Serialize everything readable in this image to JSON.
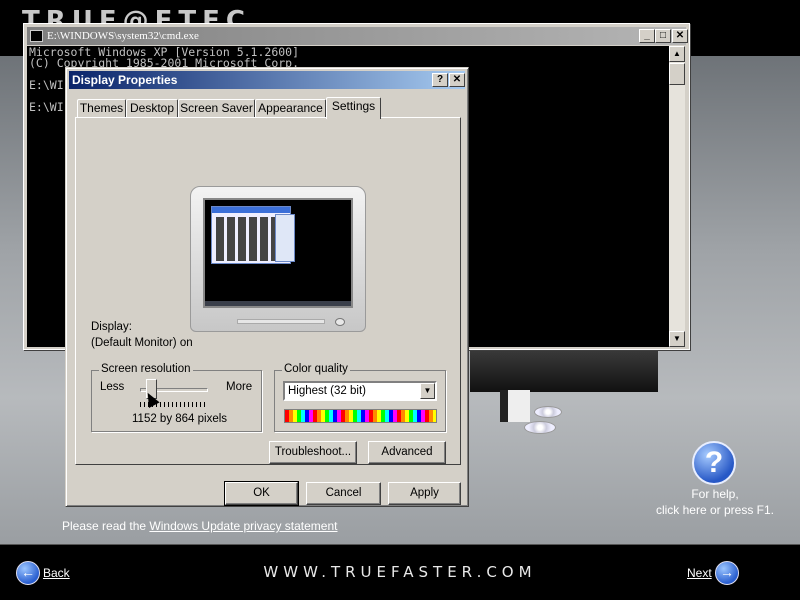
{
  "background": {
    "brand": "TRUE@FTEC",
    "website": "WWW.TRUEFASTER.COM",
    "back_label": "Back",
    "next_label": "Next",
    "help_line1": "For help,",
    "help_line2": "click here or press F1.",
    "privacy_prefix": "Please read the ",
    "privacy_link": "Windows Update privacy statement"
  },
  "cmd": {
    "title": "E:\\WINDOWS\\system32\\cmd.exe",
    "lines": [
      "Microsoft Windows XP [Version 5.1.2600]",
      "(C) Copyright 1985-2001 Microsoft Corp.",
      "",
      "E:\\WI",
      "",
      "E:\\WI"
    ]
  },
  "dialog": {
    "title": "Display Properties",
    "tabs": [
      "Themes",
      "Desktop",
      "Screen Saver",
      "Appearance",
      "Settings"
    ],
    "active_tab": "Settings",
    "display_label": "Display:",
    "display_value": "(Default Monitor) on",
    "resolution": {
      "caption": "Screen resolution",
      "less": "Less",
      "more": "More",
      "value": "1152 by 864 pixels"
    },
    "color_quality": {
      "caption": "Color quality",
      "selected": "Highest (32 bit)"
    },
    "buttons": {
      "troubleshoot": "Troubleshoot...",
      "advanced": "Advanced",
      "ok": "OK",
      "cancel": "Cancel",
      "apply": "Apply"
    }
  },
  "colors": {
    "title_active": "#0a246a",
    "title_inactive": "#7f7f7f",
    "dialog_face": "#d4d0c8"
  }
}
